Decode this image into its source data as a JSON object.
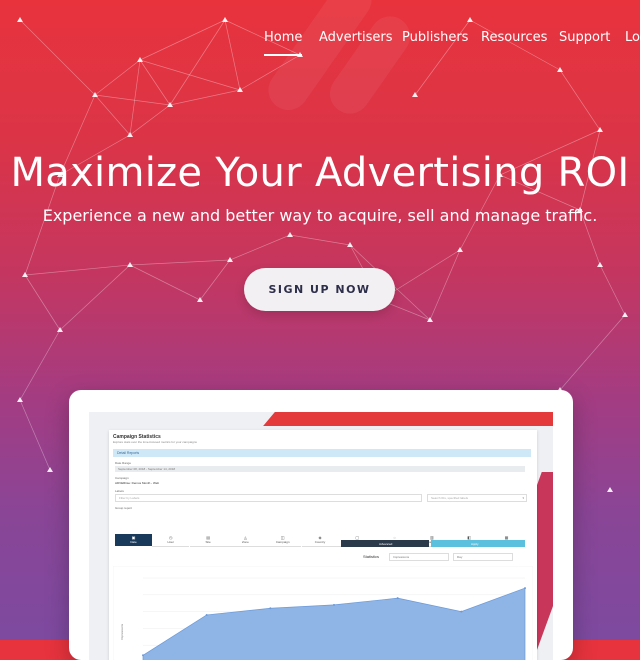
{
  "nav": {
    "items": [
      "Home",
      "Advertisers",
      "Publishers",
      "Resources",
      "Support",
      "Log"
    ],
    "active": "Home"
  },
  "hero": {
    "title": "Maximize Your Advertising ROI",
    "subtitle": "Experience a new and better way to acquire, sell and manage traffic.",
    "cta": "SIGN UP NOW"
  },
  "dashboard": {
    "title": "Campaign Statistics",
    "subtitle": "Explore stats over the time-focused metrics for your campaigns",
    "section": "Detail Reports",
    "date_label": "Date Range",
    "date_value": "September 08, 2018 - September 14, 2018",
    "campaign_label": "Campaign",
    "campaign_value": "ADVERtise: Demos Month - Web",
    "labels_label": "Labels",
    "labels_placeholder": "Filter by Labels",
    "search_placeholder": "Search IDs, specified labels",
    "group_label": "Group report",
    "tabs": [
      {
        "icon": "▣",
        "label": "Date"
      },
      {
        "icon": "◷",
        "label": "Hour"
      },
      {
        "icon": "▤",
        "label": "Site"
      },
      {
        "icon": "◬",
        "label": "Zone"
      },
      {
        "icon": "◫",
        "label": "Campaign"
      },
      {
        "icon": "◈",
        "label": "Country"
      },
      {
        "icon": "▢",
        "label": "Device"
      },
      {
        "icon": "◌",
        "label": "Language"
      },
      {
        "icon": "▥",
        "label": "Domain"
      },
      {
        "icon": "◧",
        "label": "SSV"
      },
      {
        "icon": "▦",
        "label": "Traffic"
      }
    ],
    "reset_label": "Advanced",
    "apply_label": "Apply",
    "chart_ctl_label": "Statistics",
    "chart_ctl_1": "Impressions",
    "chart_ctl_2": "Day",
    "ylabel": "Impressions",
    "chart_data": {
      "type": "area",
      "values": [
        2,
        14,
        16,
        17,
        19,
        15,
        22
      ],
      "ylim": [
        0,
        25
      ]
    }
  },
  "colors": {
    "accent": "#1a3a5c",
    "area": "#8fb4e6",
    "section_bg": "#cfe8f7",
    "apply": "#5bc0de",
    "stripe": "#e43a3c"
  }
}
